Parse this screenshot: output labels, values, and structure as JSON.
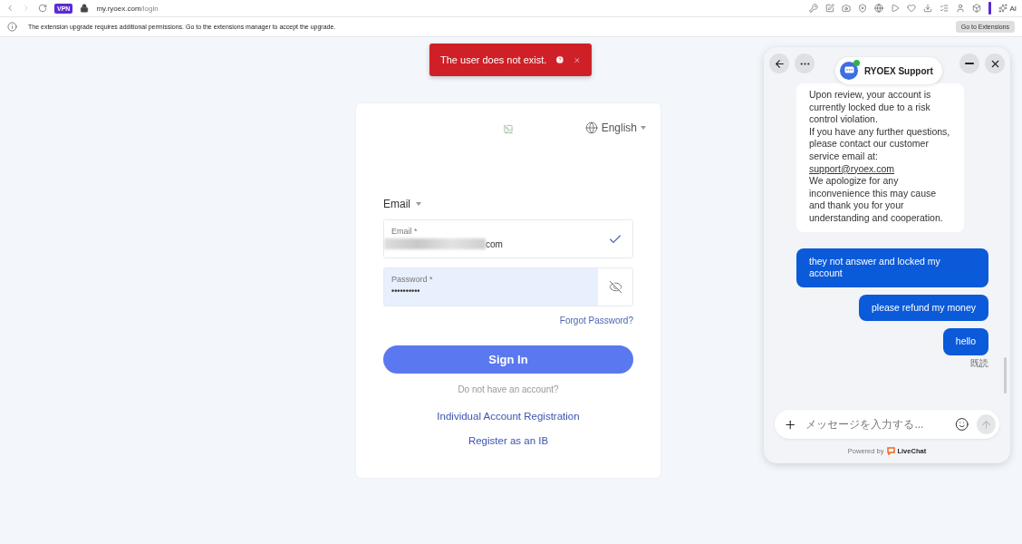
{
  "browser": {
    "url_host": "my.ryoex.com",
    "url_path": "/login",
    "vpn_badge": "VPN",
    "ai_label": "AI"
  },
  "infobar": {
    "message": "The extension upgrade requires additional permissions. Go to the extensions manager to accept the upgrade.",
    "button": "Go to Extensions"
  },
  "toast": {
    "message": "The user does not exist."
  },
  "login": {
    "language": "English",
    "login_method": "Email",
    "email": {
      "label": "Email *",
      "value": "com",
      "valid": true
    },
    "password": {
      "label": "Password *",
      "value": "••••••••••",
      "focused": true
    },
    "forgot": "Forgot Password?",
    "submit": "Sign In",
    "no_account": "Do not have an account?",
    "links": [
      "Individual Account Registration",
      "Register as an IB"
    ]
  },
  "chat": {
    "title": "RYOEX Support",
    "online": true,
    "messages": [
      {
        "kind": "agent",
        "lines": [
          {
            "kind": "text",
            "text": "Upon review, your account is currently locked due to a risk control violation."
          },
          {
            "kind": "text",
            "text": "If you have any further questions, please contact our customer service email at:"
          },
          {
            "kind": "link",
            "text": "support@ryoex.com"
          },
          {
            "kind": "text",
            "text": "We apologize for any inconvenience this may cause and thank you for your understanding and cooperation."
          }
        ]
      },
      {
        "kind": "user",
        "lines": [
          {
            "kind": "text",
            "text": "they not answer and locked my account"
          }
        ]
      },
      {
        "kind": "user",
        "lines": [
          {
            "kind": "text",
            "text": "please refund my money"
          }
        ]
      },
      {
        "kind": "user",
        "lines": [
          {
            "kind": "text",
            "text": "hello"
          }
        ]
      }
    ],
    "read_receipt": "既読",
    "input_placeholder": "メッセージを入力する...",
    "powered_by": "Powered by",
    "brand": "LiveChat"
  }
}
